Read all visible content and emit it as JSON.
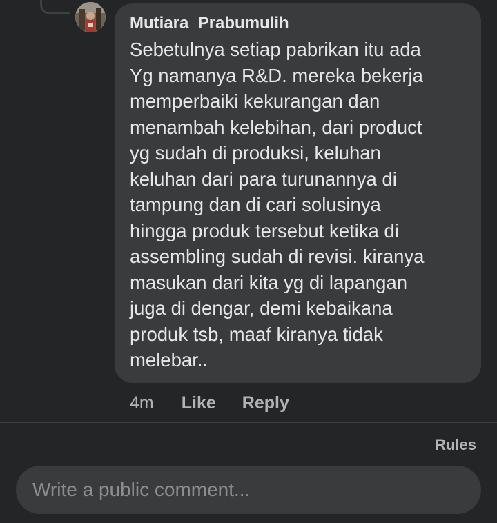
{
  "comment": {
    "author": "Mutiara  Prabumulih",
    "text": "Sebetulnya setiap pabrikan itu ada\nYg namanya R&D. mereka bekerja\nmemperbaiki kekurangan dan\nmenambah kelebihan, dari product\nyg sudah di produksi, keluhan\nkeluhan dari para turunannya di\ntampung dan di cari solusinya\nhingga produk tersebut ketika di\nassembling sudah di revisi. kiranya\nmasukan dari kita yg di lapangan\njuga di dengar, demi kebaikana\nproduk tsb, maaf kiranya tidak\nmelebar..",
    "timestamp": "4m",
    "like_label": "Like",
    "reply_label": "Reply"
  },
  "footer": {
    "rules_label": "Rules",
    "comment_placeholder": "Write a public comment..."
  },
  "colors": {
    "background": "#242526",
    "bubble": "#3a3b3c",
    "primary_text": "#e4e6eb",
    "secondary_text": "#b0b3b8"
  }
}
